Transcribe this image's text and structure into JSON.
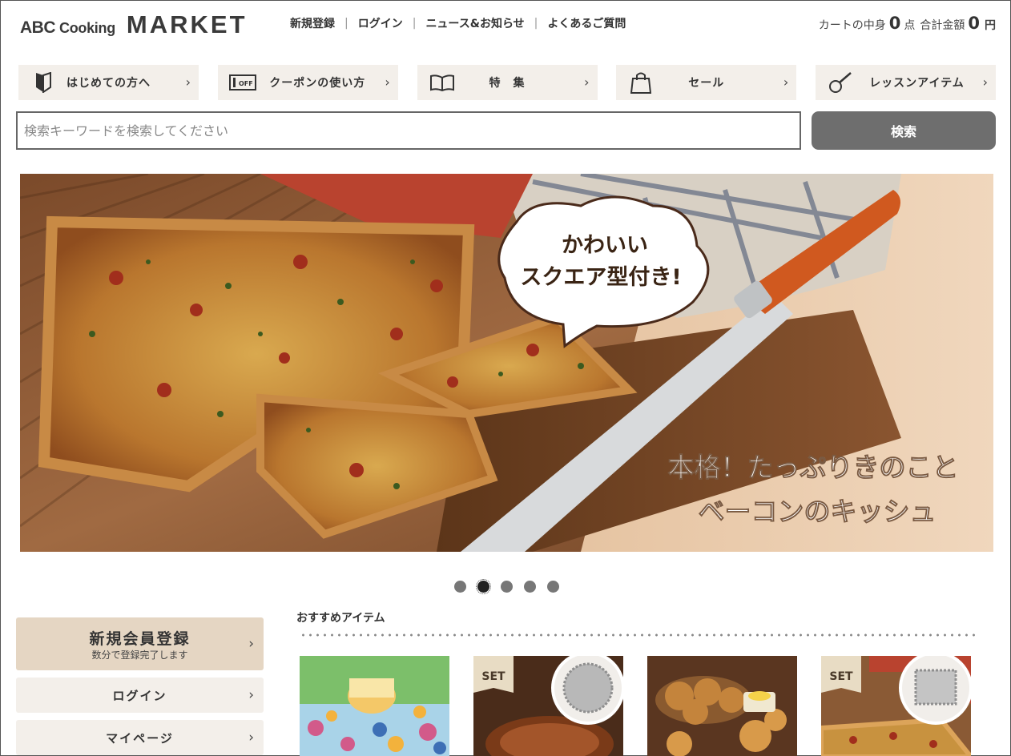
{
  "header": {
    "logo": {
      "abc": "ABC",
      "cooking": "Cooking",
      "market": "MARKET"
    },
    "nav": [
      "新規登録",
      "ログイン",
      "ニュース&お知らせ",
      "よくあるご質問"
    ],
    "cart": {
      "label": "カートの中身",
      "count": "0",
      "count_unit": "点",
      "total_label": "合計金額",
      "total": "0",
      "currency": "円"
    }
  },
  "categories": [
    {
      "label": "はじめての方へ",
      "icon": "beginner-mark-icon"
    },
    {
      "label": "クーポンの使い方",
      "icon": "coupon-off-icon"
    },
    {
      "label": "特　集",
      "icon": "open-book-icon"
    },
    {
      "label": "セール",
      "icon": "shopping-bag-icon"
    },
    {
      "label": "レッスンアイテム",
      "icon": "ladle-icon"
    }
  ],
  "search": {
    "placeholder": "検索キーワードを検索してください",
    "value": "",
    "button": "検索"
  },
  "hero": {
    "bubble_line1": "かわいい",
    "bubble_line2": "スクエア型付き!",
    "caption_line1": "本格！たっぷりきのこと",
    "caption_line2": "ベーコンのキッシュ"
  },
  "slider": {
    "count": 5,
    "active_index": 1
  },
  "sidebar": {
    "register_title": "新規会員登録",
    "register_sub": "数分で登録完了します",
    "login": "ログイン",
    "mypage": "マイページ"
  },
  "recommend": {
    "title": "おすすめアイテム",
    "items": [
      {
        "badge": ""
      },
      {
        "badge": "SET"
      },
      {
        "badge": ""
      },
      {
        "badge": "SET"
      }
    ]
  },
  "colors": {
    "category_bg": "#f3efea",
    "register_bg": "#e5d6c3",
    "search_button": "#6e6e6e"
  }
}
